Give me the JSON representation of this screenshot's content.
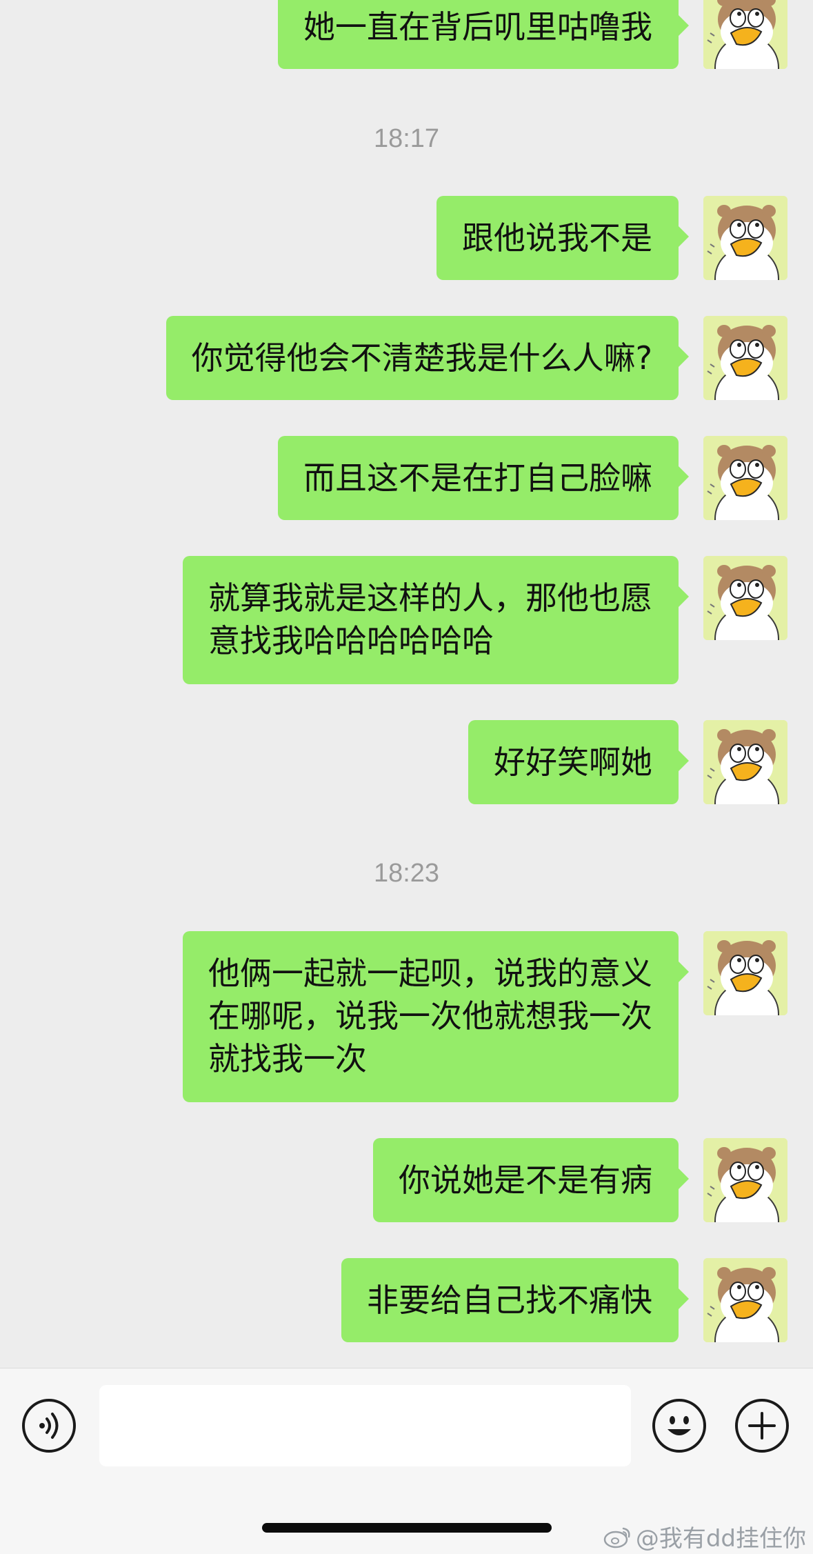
{
  "messages": [
    {
      "text": "她一直在背后叽里咕噜我"
    },
    {
      "text": "跟他说我不是"
    },
    {
      "text": "你觉得他会不清楚我是什么人嘛?"
    },
    {
      "text": "而且这不是在打自己脸嘛"
    },
    {
      "text": "就算我就是这样的人，那他也愿\n意找我哈哈哈哈哈哈"
    },
    {
      "text": "好好笑啊她"
    },
    {
      "text": "他俩一起就一起呗，说我的意义\n在哪呢，说我一次他就想我一次\n就找我一次"
    },
    {
      "text": "你说她是不是有病"
    },
    {
      "text": "非要给自己找不痛快"
    }
  ],
  "timestamps": [
    "18:17",
    "18:23"
  ],
  "input": {
    "value": "",
    "placeholder": ""
  },
  "icons": {
    "voice": "voice-input-icon",
    "emoji": "emoji-icon",
    "plus": "plus-icon"
  },
  "watermark": {
    "text": "@我有dd挂住你"
  },
  "colors": {
    "bubble": "#95ec69",
    "background": "#ededed",
    "input_bar": "#f6f6f6"
  }
}
